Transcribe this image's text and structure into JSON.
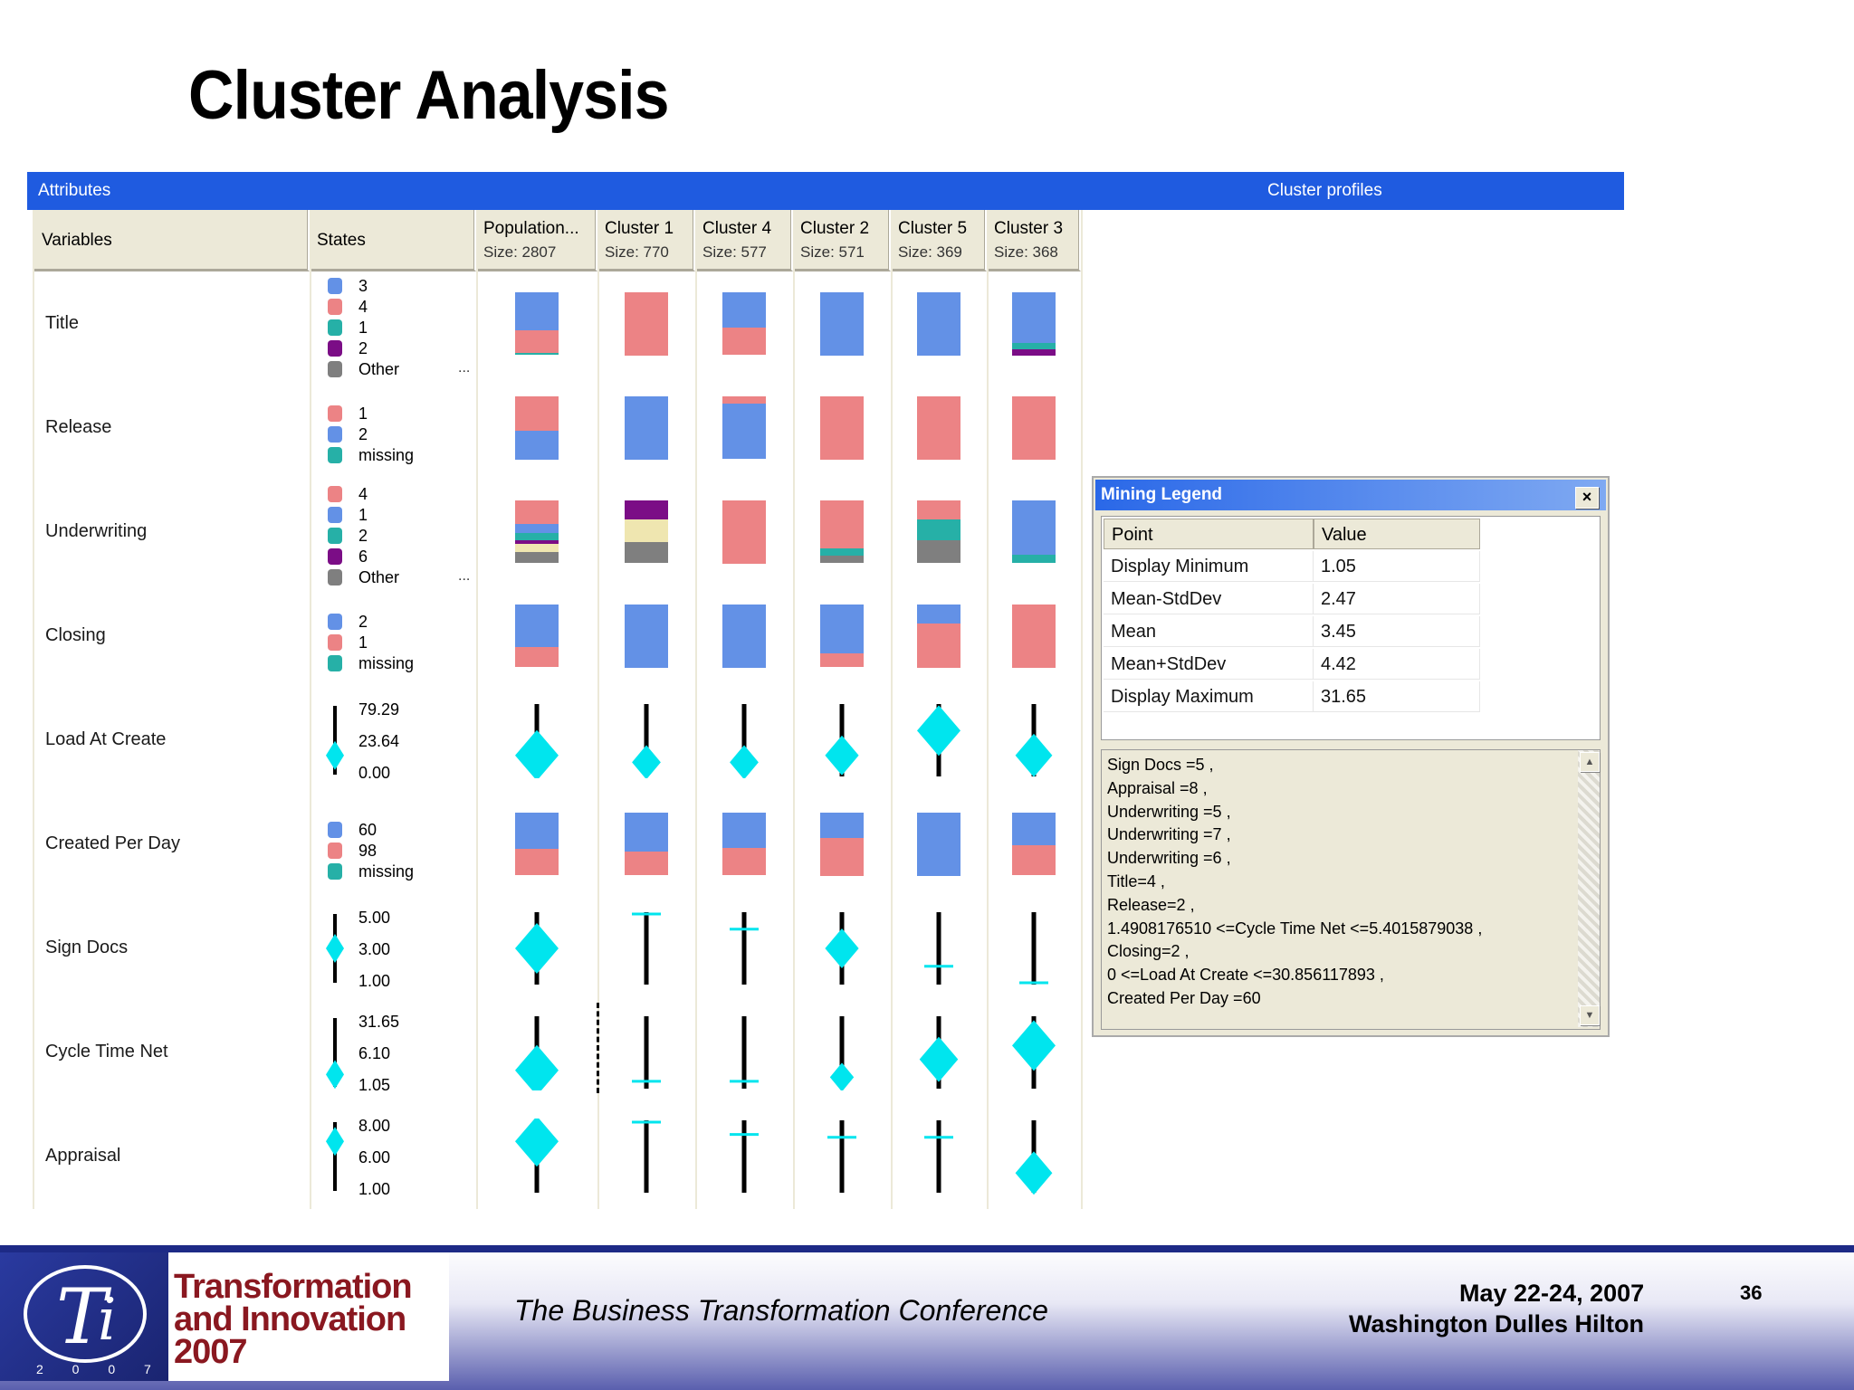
{
  "slide": {
    "title": "Cluster Analysis"
  },
  "window": {
    "attributes_label": "Attributes",
    "profiles_label": "Cluster profiles"
  },
  "columns": {
    "variables": "Variables",
    "states": "States",
    "clusters": [
      {
        "name": "Population...",
        "size": "Size: 2807"
      },
      {
        "name": "Cluster 1",
        "size": "Size: 770"
      },
      {
        "name": "Cluster 4",
        "size": "Size: 577"
      },
      {
        "name": "Cluster 2",
        "size": "Size: 571"
      },
      {
        "name": "Cluster 5",
        "size": "Size: 369"
      },
      {
        "name": "Cluster 3",
        "size": "Size: 368"
      }
    ]
  },
  "colors": {
    "blue": "#6391e6",
    "red": "#ec8385",
    "teal": "#26b0a7",
    "purple": "#7b0d86",
    "gray": "#7f7f7f",
    "cream": "#efe6b0",
    "cyan": "#00e5ee"
  },
  "variables": [
    {
      "name": "Title",
      "type": "discrete",
      "states": [
        {
          "label": "3",
          "color": "blue"
        },
        {
          "label": "4",
          "color": "red"
        },
        {
          "label": "1",
          "color": "teal"
        },
        {
          "label": "2",
          "color": "purple"
        },
        {
          "label": "Other",
          "color": "gray"
        }
      ],
      "more": "...",
      "profiles": [
        [
          {
            "c": "blue",
            "v": 0.6
          },
          {
            "c": "red",
            "v": 0.37
          },
          {
            "c": "teal",
            "v": 0.03
          }
        ],
        [
          {
            "c": "red",
            "v": 1.0
          }
        ],
        [
          {
            "c": "blue",
            "v": 0.56
          },
          {
            "c": "red",
            "v": 0.44
          }
        ],
        [
          {
            "c": "blue",
            "v": 1.0
          }
        ],
        [
          {
            "c": "blue",
            "v": 1.0
          }
        ],
        [
          {
            "c": "blue",
            "v": 0.8
          },
          {
            "c": "teal",
            "v": 0.1
          },
          {
            "c": "purple",
            "v": 0.1
          }
        ]
      ]
    },
    {
      "name": "Release",
      "type": "discrete",
      "states": [
        {
          "label": "1",
          "color": "red"
        },
        {
          "label": "2",
          "color": "blue"
        },
        {
          "label": "missing",
          "color": "teal"
        }
      ],
      "profiles": [
        [
          {
            "c": "red",
            "v": 0.55
          },
          {
            "c": "blue",
            "v": 0.45
          }
        ],
        [
          {
            "c": "blue",
            "v": 1.0
          }
        ],
        [
          {
            "c": "red",
            "v": 0.12
          },
          {
            "c": "blue",
            "v": 0.88
          }
        ],
        [
          {
            "c": "red",
            "v": 1.0
          }
        ],
        [
          {
            "c": "red",
            "v": 1.0
          }
        ],
        [
          {
            "c": "red",
            "v": 1.0
          }
        ]
      ]
    },
    {
      "name": "Underwriting",
      "type": "discrete",
      "states": [
        {
          "label": "4",
          "color": "red"
        },
        {
          "label": "1",
          "color": "blue"
        },
        {
          "label": "2",
          "color": "teal"
        },
        {
          "label": "6",
          "color": "purple"
        },
        {
          "label": "Other",
          "color": "gray"
        }
      ],
      "more": "...",
      "profiles": [
        [
          {
            "c": "red",
            "v": 0.38
          },
          {
            "c": "blue",
            "v": 0.14
          },
          {
            "c": "teal",
            "v": 0.12
          },
          {
            "c": "purple",
            "v": 0.06
          },
          {
            "c": "cream",
            "v": 0.12
          },
          {
            "c": "gray",
            "v": 0.18
          }
        ],
        [
          {
            "c": "purple",
            "v": 0.3
          },
          {
            "c": "cream",
            "v": 0.36
          },
          {
            "c": "gray",
            "v": 0.34
          }
        ],
        [
          {
            "c": "red",
            "v": 1.0
          }
        ],
        [
          {
            "c": "red",
            "v": 0.76
          },
          {
            "c": "teal",
            "v": 0.12
          },
          {
            "c": "gray",
            "v": 0.12
          }
        ],
        [
          {
            "c": "red",
            "v": 0.3
          },
          {
            "c": "teal",
            "v": 0.34
          },
          {
            "c": "gray",
            "v": 0.36
          }
        ],
        [
          {
            "c": "blue",
            "v": 0.86
          },
          {
            "c": "teal",
            "v": 0.14
          }
        ]
      ]
    },
    {
      "name": "Closing",
      "type": "discrete",
      "states": [
        {
          "label": "2",
          "color": "blue"
        },
        {
          "label": "1",
          "color": "red"
        },
        {
          "label": "missing",
          "color": "teal"
        }
      ],
      "profiles": [
        [
          {
            "c": "blue",
            "v": 0.68
          },
          {
            "c": "red",
            "v": 0.32
          }
        ],
        [
          {
            "c": "blue",
            "v": 1.0
          }
        ],
        [
          {
            "c": "blue",
            "v": 1.0
          }
        ],
        [
          {
            "c": "blue",
            "v": 0.78
          },
          {
            "c": "red",
            "v": 0.22
          }
        ],
        [
          {
            "c": "blue",
            "v": 0.3
          },
          {
            "c": "red",
            "v": 0.7
          }
        ],
        [
          {
            "c": "red",
            "v": 1.0
          }
        ]
      ]
    },
    {
      "name": "Load At Create",
      "type": "continuous",
      "scale": [
        "79.29",
        "23.64",
        "0.00"
      ],
      "legend_diamond": 0.72,
      "profiles": [
        {
          "pos": 0.72,
          "size": 1.0
        },
        {
          "pos": 0.82,
          "size": 0.55
        },
        {
          "pos": 0.82,
          "size": 0.55
        },
        {
          "pos": 0.72,
          "size": 0.7
        },
        {
          "pos": 0.36,
          "size": 1.0
        },
        {
          "pos": 0.72,
          "size": 0.8
        }
      ]
    },
    {
      "name": "Created Per Day",
      "type": "discrete",
      "states": [
        {
          "label": "60",
          "color": "blue"
        },
        {
          "label": "98",
          "color": "red"
        },
        {
          "label": "missing",
          "color": "teal"
        }
      ],
      "profiles": [
        [
          {
            "c": "blue",
            "v": 0.58
          },
          {
            "c": "red",
            "v": 0.42
          }
        ],
        [
          {
            "c": "blue",
            "v": 0.62
          },
          {
            "c": "red",
            "v": 0.38
          }
        ],
        [
          {
            "c": "blue",
            "v": 0.56
          },
          {
            "c": "red",
            "v": 0.44
          }
        ],
        [
          {
            "c": "blue",
            "v": 0.4
          },
          {
            "c": "red",
            "v": 0.6
          }
        ],
        [
          {
            "c": "blue",
            "v": 1.0
          }
        ],
        [
          {
            "c": "blue",
            "v": 0.52
          },
          {
            "c": "red",
            "v": 0.48
          }
        ]
      ]
    },
    {
      "name": "Sign Docs",
      "type": "continuous",
      "scale": [
        "5.00",
        "3.00",
        "1.00"
      ],
      "legend_diamond": 0.5,
      "profiles": [
        {
          "pos": 0.5,
          "size": 1.0
        },
        {
          "pos": 0.0,
          "size": 0.0
        },
        {
          "pos": 0.22,
          "size": 0.0
        },
        {
          "pos": 0.5,
          "size": 0.7
        },
        {
          "pos": 0.76,
          "size": 0.0
        },
        {
          "pos": 1.0,
          "size": 0.0
        }
      ]
    },
    {
      "name": "Cycle Time Net",
      "type": "continuous",
      "scale": [
        "31.65",
        "6.10",
        "1.05"
      ],
      "legend_diamond": 0.82,
      "profiles": [
        {
          "pos": 0.76,
          "size": 1.0
        },
        {
          "pos": 0.92,
          "size": 0.0
        },
        {
          "pos": 0.92,
          "size": 0.0
        },
        {
          "pos": 0.86,
          "size": 0.4
        },
        {
          "pos": 0.6,
          "size": 0.85
        },
        {
          "pos": 0.4,
          "size": 1.0
        }
      ]
    },
    {
      "name": "Appraisal",
      "type": "continuous",
      "scale": [
        "8.00",
        "6.00",
        "1.00"
      ],
      "legend_diamond": 0.28,
      "profiles": [
        {
          "pos": 0.28,
          "size": 1.0
        },
        {
          "pos": 0.0,
          "size": 0.0
        },
        {
          "pos": 0.18,
          "size": 0.0
        },
        {
          "pos": 0.22,
          "size": 0.0
        },
        {
          "pos": 0.22,
          "size": 0.0
        },
        {
          "pos": 0.74,
          "size": 0.8
        }
      ]
    }
  ],
  "mining_legend": {
    "title": "Mining Legend",
    "close": "×",
    "headers": [
      "Point",
      "Value"
    ],
    "rows": [
      [
        "Display Minimum",
        "1.05"
      ],
      [
        "Mean-StdDev",
        "2.47"
      ],
      [
        "Mean",
        "3.45"
      ],
      [
        "Mean+StdDev",
        "4.42"
      ],
      [
        "Display Maximum",
        "31.65"
      ]
    ],
    "rule_lines": [
      "Sign Docs =5 ,",
      "Appraisal =8 ,",
      "Underwriting =5 ,",
      "Underwriting =7 ,",
      "Underwriting =6 ,",
      "Title=4 ,",
      "Release=2 ,",
      "1.4908176510 <=Cycle Time Net <=5.4015879038 ,",
      "Closing=2 ,",
      "0 <=Load At Create <=30.856117893 ,",
      "Created Per Day =60"
    ]
  },
  "footer": {
    "logo_line1": "Transformation",
    "logo_line2": "and Innovation",
    "logo_line3": "2007",
    "logo_year_digits": "2 0 0 7",
    "conference": "The Business Transformation Conference",
    "date": "May 22-24, 2007",
    "venue": "Washington Dulles Hilton",
    "page": "36"
  }
}
